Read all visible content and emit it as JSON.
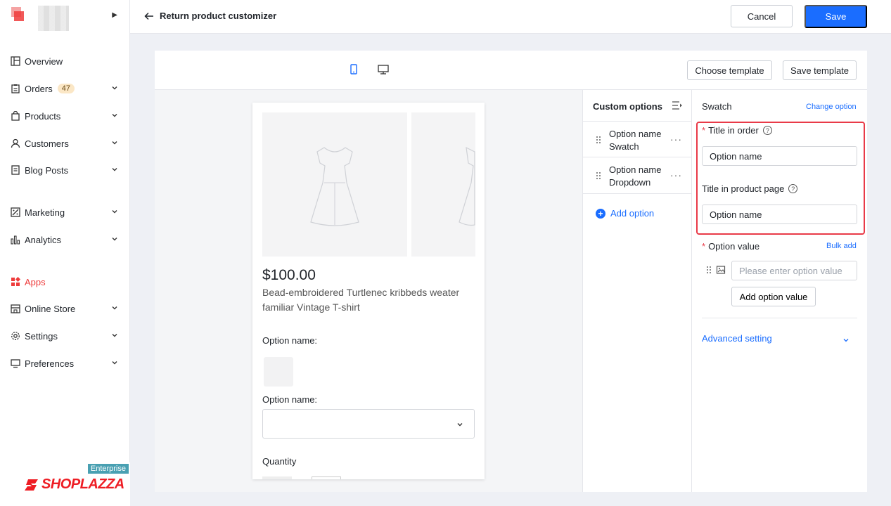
{
  "sidebar": {
    "items": [
      {
        "label": "Overview",
        "icon": "overview-icon"
      },
      {
        "label": "Orders",
        "icon": "orders-icon",
        "badge": "47"
      },
      {
        "label": "Products",
        "icon": "products-icon"
      },
      {
        "label": "Customers",
        "icon": "customers-icon"
      },
      {
        "label": "Blog Posts",
        "icon": "blog-icon"
      },
      {
        "label": "Marketing",
        "icon": "marketing-icon"
      },
      {
        "label": "Analytics",
        "icon": "analytics-icon"
      },
      {
        "label": "Apps",
        "icon": "apps-icon"
      },
      {
        "label": "Online Store",
        "icon": "store-icon"
      },
      {
        "label": "Settings",
        "icon": "gear-icon"
      },
      {
        "label": "Preferences",
        "icon": "monitor-icon"
      }
    ],
    "brand": "SHOPLAZZA",
    "edition": "Enterprise"
  },
  "topbar": {
    "back_label": "Return product customizer",
    "cancel_label": "Cancel",
    "save_label": "Save"
  },
  "toolbar": {
    "choose_template": "Choose template",
    "save_template": "Save template"
  },
  "preview": {
    "price": "$100.00",
    "title": "Bead-embroidered Turtlenec kribbeds weater familiar Vintage T-shirt",
    "option_label_1": "Option name:",
    "option_label_2": "Option name:",
    "quantity_label": "Quantity"
  },
  "options_panel": {
    "title": "Custom options",
    "items": [
      {
        "name": "Option name",
        "type": "Swatch"
      },
      {
        "name": "Option name",
        "type": "Dropdown"
      }
    ],
    "add_label": "Add option"
  },
  "settings": {
    "type_title": "Swatch",
    "change_option": "Change option",
    "title_in_order_label": "Title in order",
    "title_in_order_value": "Option name",
    "title_in_page_label": "Title in product page",
    "title_in_page_value": "Option name",
    "option_value_label": "Option value",
    "bulk_add": "Bulk add",
    "option_value_placeholder": "Please enter option value",
    "add_value_label": "Add option value",
    "advanced_label": "Advanced setting"
  },
  "colors": {
    "accent": "#1a6dff",
    "brand_red": "#ee1d24",
    "highlight": "#e93a48"
  }
}
